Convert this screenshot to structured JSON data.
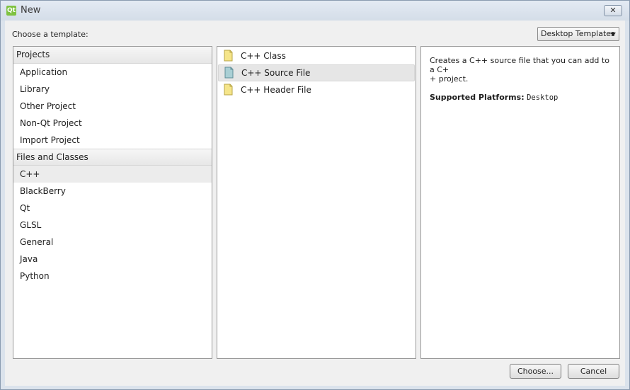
{
  "window": {
    "title": "New",
    "app_icon_text": "Qt",
    "close_glyph": "✕"
  },
  "header": {
    "choose_label": "Choose a template:",
    "filter_value": "Desktop Templates"
  },
  "categories": {
    "groups": [
      {
        "label": "Projects",
        "items": [
          "Application",
          "Library",
          "Other Project",
          "Non-Qt Project",
          "Import Project"
        ]
      },
      {
        "label": "Files and Classes",
        "items": [
          "C++",
          "BlackBerry",
          "Qt",
          "GLSL",
          "General",
          "Java",
          "Python"
        ]
      }
    ],
    "selected": "C++"
  },
  "templates": {
    "items": [
      "C++ Class",
      "C++ Source File",
      "C++ Header File"
    ],
    "selected": "C++ Source File",
    "icons": [
      "file-yellow-icon",
      "file-teal-icon",
      "file-yellow-icon"
    ]
  },
  "description": {
    "line1": "Creates a C++ source file that you can add to a C+",
    "line2": "+ project.",
    "platforms_label": "Supported Platforms:",
    "platforms_value": "Desktop"
  },
  "buttons": {
    "choose": "Choose...",
    "cancel": "Cancel"
  },
  "colors": {
    "file_yellow": "#f5e58a",
    "file_teal": "#a9cfd4"
  }
}
